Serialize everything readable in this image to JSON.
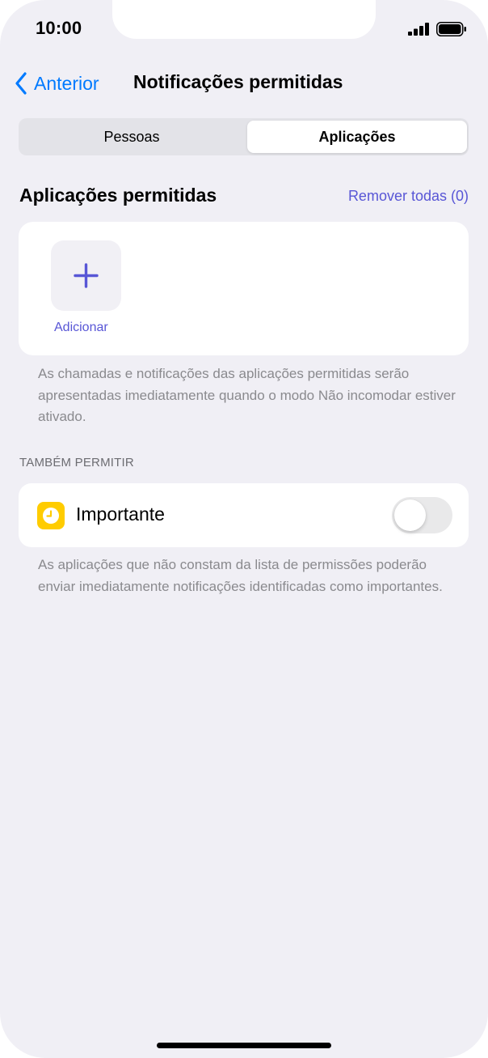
{
  "status_bar": {
    "time": "10:00",
    "signal_icon": "cellular-signal-icon",
    "battery_icon": "battery-icon"
  },
  "nav": {
    "back_label": "Anterior",
    "back_icon": "chevron-left-icon",
    "title": "Notificações permitidas"
  },
  "segments": {
    "items": [
      "Pessoas",
      "Aplicações"
    ],
    "selected": "Aplicações"
  },
  "allowed_apps": {
    "title": "Aplicações permitidas",
    "remove_all_label": "Remover todas (0)",
    "add_label": "Adicionar",
    "add_icon": "plus-icon",
    "footnote": "As chamadas e notificações das aplicações permitidas serão apresentadas imediatamente quando o modo Não incomodar estiver ativado."
  },
  "also_allow": {
    "header": "TAMBÉM PERMITIR",
    "important": {
      "label": "Importante",
      "icon": "clock-icon",
      "enabled": false
    },
    "footnote": "As aplicações que não constam da lista de permissões poderão enviar imediatamente notificações identificadas como importantes."
  },
  "colors": {
    "accent_blue": "#007aff",
    "accent_indigo": "#5856d6",
    "background": "#f0eff5",
    "important_icon_bg": "#ffcc00"
  }
}
